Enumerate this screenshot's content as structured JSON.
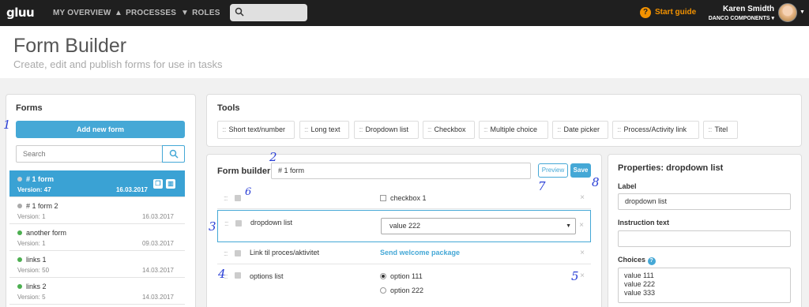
{
  "nav": {
    "logo": "gluu",
    "overview": "MY OVERVIEW",
    "processes": "PROCESSES",
    "roles": "ROLES",
    "start_guide": "Start guide",
    "user_name": "Karen Smidth",
    "company": "DANCO COMPONENTS"
  },
  "header": {
    "title": "Form Builder",
    "subtitle": "Create, edit and publish forms for use in tasks"
  },
  "forms": {
    "title": "Forms",
    "add_label": "Add new form",
    "search_placeholder": "Search",
    "items": [
      {
        "name": "# 1 form",
        "version": "Version: 47",
        "date": "16.03.2017",
        "status_color": "#cccccc"
      },
      {
        "name": "# 1 form 2",
        "version": "Version: 1",
        "date": "16.03.2017",
        "status_color": "#aaaaaa"
      },
      {
        "name": "another form",
        "version": "Version: 1",
        "date": "09.03.2017",
        "status_color": "#4caf50"
      },
      {
        "name": "links 1",
        "version": "Version: 50",
        "date": "14.03.2017",
        "status_color": "#4caf50"
      },
      {
        "name": "links 2",
        "version": "Version: 5",
        "date": "14.03.2017",
        "status_color": "#4caf50"
      }
    ]
  },
  "tools": {
    "title": "Tools",
    "items": [
      "Short text/number",
      "Long text",
      "Dropdown list",
      "Checkbox",
      "Multiple choice",
      "Date picker",
      "Process/Activity link",
      "Titel"
    ]
  },
  "builder": {
    "title": "Form builder",
    "name_value": "# 1 form",
    "preview_label": "Preview",
    "save_label": "Save",
    "rows": {
      "checkbox_option": "checkbox 1",
      "dropdown_label": "dropdown list",
      "dropdown_value": "value 222",
      "link_label": "Link til proces/aktivitet",
      "link_value": "Send welcome package",
      "options_label": "options list",
      "option_1": "option 111",
      "option_2": "option 222"
    }
  },
  "properties": {
    "title": "Properties: dropdown list",
    "label_caption": "Label",
    "label_value": "dropdown list",
    "instruction_caption": "Instruction text",
    "instruction_value": "",
    "choices_caption": "Choices",
    "choices": [
      "value 111",
      "value 222",
      "value 333"
    ]
  },
  "annotations": [
    "1",
    "2",
    "3",
    "4",
    "5",
    "6",
    "7",
    "8"
  ],
  "colors": {
    "accent": "#45a8d6",
    "nav_bg": "#1f1f1f",
    "start_guide": "#f39200",
    "annotation": "#2a3fd6"
  }
}
